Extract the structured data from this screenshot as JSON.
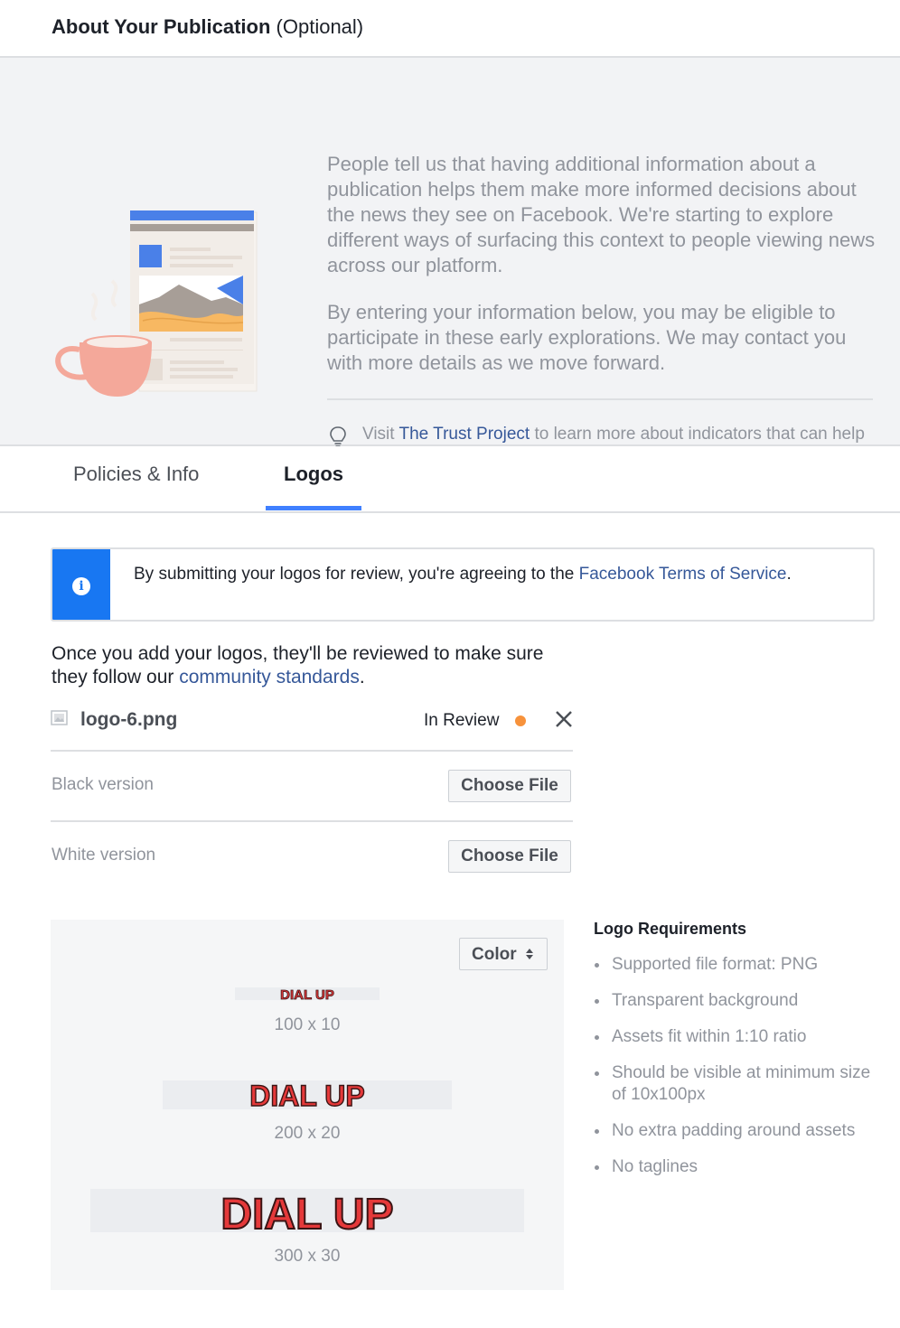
{
  "header": {
    "title": "About Your Publication",
    "optional": "(Optional)"
  },
  "intro": {
    "paragraph1": "People tell us that having additional information about a publication helps them make more informed decisions about the news they see on Facebook. We're starting to explore different ways of surfacing this context to people viewing news across our platform.",
    "paragraph2": "By entering your information below, you may be eligible to participate in these early explorations. We may contact you with more details as we move forward.",
    "trust": {
      "prefix": "Visit",
      "link": "The Trust Project",
      "suffix": "to learn more about indicators that can help build trust with your audience."
    }
  },
  "tabs": {
    "policies": "Policies & Info",
    "logos": "Logos",
    "active": "Logos"
  },
  "notice": {
    "text": "By submitting your logos for review, you're agreeing to the",
    "link": "Facebook Terms of Service",
    "end": "."
  },
  "review": {
    "text": "Once you add your logos, they'll be reviewed to make sure they follow our",
    "link": "community standards",
    "end": "."
  },
  "file": {
    "name": "logo-6.png",
    "status": "In Review",
    "status_color": "#f7923b"
  },
  "versions": {
    "black": {
      "label": "Black version",
      "button": "Choose File"
    },
    "white": {
      "label": "White version",
      "button": "Choose File"
    }
  },
  "preview": {
    "color_option": "Color",
    "logo_text": "DIAL UP",
    "sizes": [
      {
        "label": "100 x 10"
      },
      {
        "label": "200 x 20"
      },
      {
        "label": "300 x 30"
      }
    ]
  },
  "requirements": {
    "title": "Logo Requirements",
    "items": [
      "Supported file format: PNG",
      "Transparent background",
      "Assets fit within 1:10 ratio",
      "Should be visible at minimum size of 10x100px",
      "No extra padding around assets",
      "No taglines"
    ]
  },
  "colors": {
    "link": "#365899",
    "accent": "#4080ff",
    "notice_blue": "#1877f2",
    "logo_red": "#e5393a"
  }
}
